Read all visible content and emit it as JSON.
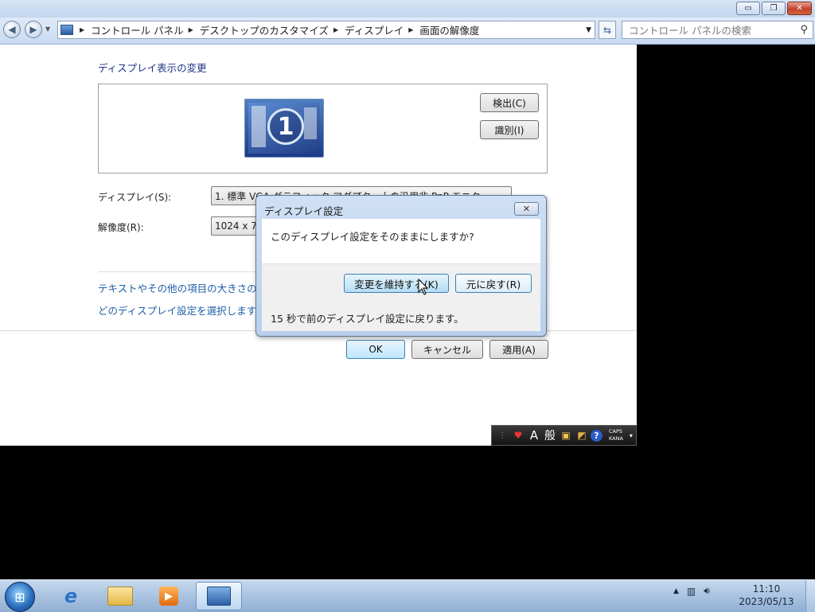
{
  "window": {
    "caption_buttons": {
      "minimize": "▭",
      "restore": "❐",
      "close": "✕"
    }
  },
  "nav": {
    "back_icon": "back-arrow-icon",
    "forward_icon": "forward-arrow-icon",
    "breadcrumbs": [
      "コントロール パネル",
      "デスクトップのカスタマイズ",
      "ディスプレイ",
      "画面の解像度"
    ],
    "search_placeholder": "コントロール パネルの検索"
  },
  "content": {
    "page_title": "ディスプレイ表示の変更",
    "monitor_number": "1",
    "detect_button": "検出(C)",
    "identify_button": "識別(I)",
    "display_label": "ディスプレイ(S):",
    "display_value": "1. 標準 VGA グラフィック アダプター上の汎用非 PnP モニター",
    "resolution_label": "解像度(R):",
    "resolution_value": "1024 x 768",
    "link_text_size": "テキストやその他の項目の大きさの変",
    "link_which_settings": "どのディスプレイ設定を選択しますか",
    "ok_button": "OK",
    "cancel_button": "キャンセル",
    "apply_button": "適用(A)"
  },
  "dialog": {
    "title": "ディスプレイ設定",
    "question": "このディスプレイ設定をそのままにしますか?",
    "keep_button": "変更を維持する(K)",
    "revert_button": "元に戻す(R)",
    "countdown": "15 秒で前のディスプレイ設定に戻ります。"
  },
  "ime": {
    "mode": "A",
    "general": "般",
    "caps": "CAPS",
    "kana": "KANA"
  },
  "taskbar": {
    "pinned_icons": [
      "start-orb-icon",
      "internet-explorer-icon",
      "windows-explorer-icon",
      "media-player-icon",
      "display-settings-icon"
    ],
    "clock_time": "11:10",
    "clock_date": "2023/05/13"
  },
  "colors": {
    "link": "#1f5fa6",
    "heading": "#1e3287",
    "dialog_frame": "#b9cfec"
  }
}
